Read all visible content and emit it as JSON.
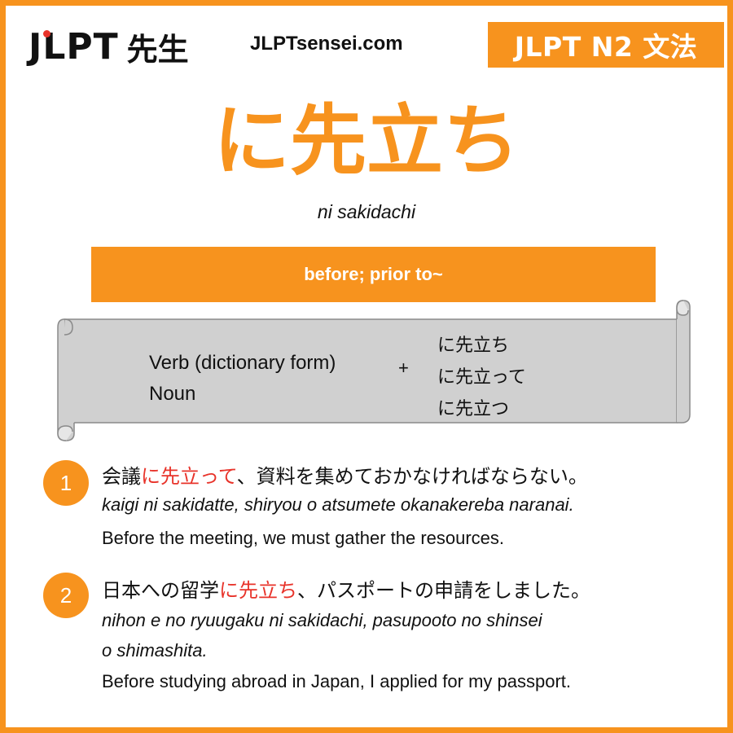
{
  "header": {
    "logo_text": "JLPT",
    "logo_kanji": "先生",
    "site_url": "JLPTsensei.com",
    "level_badge": "JLPT N2 文法"
  },
  "grammar": {
    "title": "に先立ち",
    "romaji": "ni sakidachi",
    "meaning": "before; prior to~"
  },
  "formation": {
    "left": [
      "Verb (dictionary form)",
      "Noun"
    ],
    "plus": "+",
    "right": [
      "に先立ち",
      "に先立って",
      "に先立つ"
    ]
  },
  "examples": [
    {
      "number": "1",
      "jp_before": "会議",
      "jp_highlight": "に先立って",
      "jp_after": "、資料を集めておかなければならない。",
      "romaji_lines": [
        "kaigi ni sakidatte, shiryou o atsumete okanakereba naranai."
      ],
      "english": "Before the meeting, we must gather the resources."
    },
    {
      "number": "2",
      "jp_before": "日本への留学",
      "jp_highlight": "に先立ち",
      "jp_after": "、パスポートの申請をしました。",
      "romaji_lines": [
        "nihon e no ryuugaku ni sakidachi, pasupooto no shinsei",
        "o shimashita."
      ],
      "english": "Before studying abroad in Japan, I applied for my passport."
    }
  ],
  "colors": {
    "accent": "#f7931e",
    "highlight": "#e8332a",
    "scroll_fill": "#d0d0d0",
    "scroll_stroke": "#8a8a8a"
  }
}
